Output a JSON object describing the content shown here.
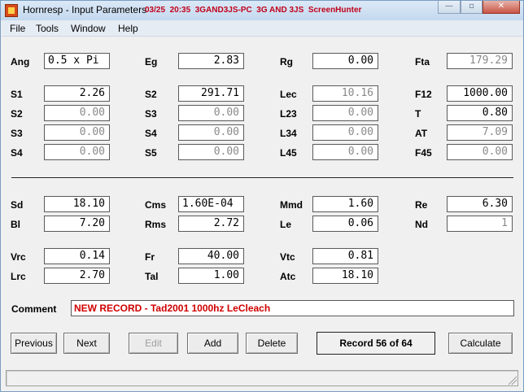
{
  "window": {
    "title": "Hornresp - Input Parameters",
    "overlay": "03/25  20:35  3GAND3JS-PC  3G AND 3JS  ScreenHunter",
    "minimize": "—",
    "maximize": "▫",
    "close": "✕"
  },
  "menu": [
    "File",
    "Tools",
    "Window",
    "Help"
  ],
  "params": {
    "ang": {
      "label": "Ang",
      "value": "0.5 x Pi"
    },
    "eg": {
      "label": "Eg",
      "value": "2.83"
    },
    "rg": {
      "label": "Rg",
      "value": "0.00"
    },
    "fta": {
      "label": "Fta",
      "value": "179.29"
    },
    "s1": {
      "label": "S1",
      "value": "2.26"
    },
    "s2a": {
      "label": "S2",
      "value": "291.71"
    },
    "lec": {
      "label": "Lec",
      "value": "10.16"
    },
    "f12": {
      "label": "F12",
      "value": "1000.00"
    },
    "s2b": {
      "label": "S2",
      "value": "0.00"
    },
    "s3a": {
      "label": "S3",
      "value": "0.00"
    },
    "l23": {
      "label": "L23",
      "value": "0.00"
    },
    "t": {
      "label": "T",
      "value": "0.80"
    },
    "s3b": {
      "label": "S3",
      "value": "0.00"
    },
    "s4a": {
      "label": "S4",
      "value": "0.00"
    },
    "l34": {
      "label": "L34",
      "value": "0.00"
    },
    "at": {
      "label": "AT",
      "value": "7.09"
    },
    "s4b": {
      "label": "S4",
      "value": "0.00"
    },
    "s5": {
      "label": "S5",
      "value": "0.00"
    },
    "l45": {
      "label": "L45",
      "value": "0.00"
    },
    "f45": {
      "label": "F45",
      "value": "0.00"
    },
    "sd": {
      "label": "Sd",
      "value": "18.10"
    },
    "cms": {
      "label": "Cms",
      "value": "1.60E-04"
    },
    "mmd": {
      "label": "Mmd",
      "value": "1.60"
    },
    "re": {
      "label": "Re",
      "value": "6.30"
    },
    "bl": {
      "label": "Bl",
      "value": "7.20"
    },
    "rms": {
      "label": "Rms",
      "value": "2.72"
    },
    "le": {
      "label": "Le",
      "value": "0.06"
    },
    "nd": {
      "label": "Nd",
      "value": "1"
    },
    "vrc": {
      "label": "Vrc",
      "value": "0.14"
    },
    "fr": {
      "label": "Fr",
      "value": "40.00"
    },
    "vtc": {
      "label": "Vtc",
      "value": "0.81"
    },
    "lrc": {
      "label": "Lrc",
      "value": "2.70"
    },
    "tal": {
      "label": "Tal",
      "value": "1.00"
    },
    "atc": {
      "label": "Atc",
      "value": "18.10"
    }
  },
  "comment": {
    "label": "Comment",
    "value": "NEW RECORD - Tad2001 1000hz LeCleach"
  },
  "buttons": {
    "previous": "Previous",
    "next": "Next",
    "edit": "Edit",
    "add": "Add",
    "delete": "Delete",
    "calculate": "Calculate"
  },
  "record": "Record 56 of 64",
  "status": ""
}
